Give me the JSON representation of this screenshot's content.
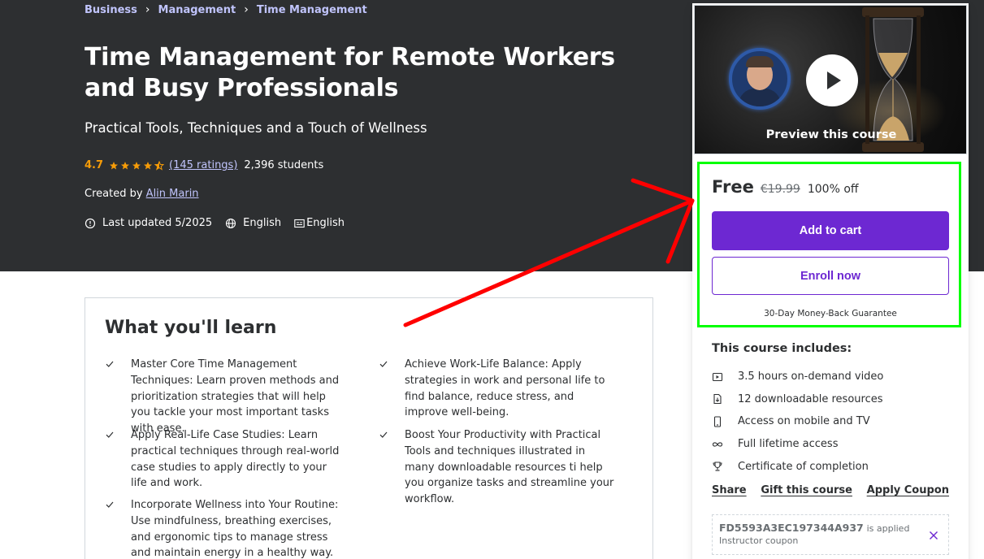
{
  "breadcrumb": {
    "items": [
      "Business",
      "Management",
      "Time Management"
    ],
    "separator": "›"
  },
  "course": {
    "title": "Time Management for Remote Workers and Busy Professionals",
    "subtitle": "Practical Tools, Techniques and a Touch of Wellness",
    "rating": "4.7",
    "rating_stars": 4.5,
    "ratings_count": "(145 ratings)",
    "students": "2,396 students",
    "created_by_label": "Created by",
    "author": "Alin Marin",
    "last_updated": "Last updated 5/2025",
    "language": "English",
    "captions": "English"
  },
  "learn": {
    "heading": "What you'll learn",
    "items": [
      "Master Core Time Management Techniques: Learn proven methods and prioritization strategies that will help you tackle your most important tasks with ease.",
      "Achieve Work-Life Balance: Apply strategies in work and personal life to find balance, reduce stress, and improve well-being.",
      "Apply Real-Life Case Studies: Learn practical techniques through real-world case studies to apply directly to your life and work.",
      "Boost Your Productivity with Practical Tools and techniques illustrated in many downloadable resources ti help you organize tasks and streamline your workflow.",
      "Incorporate Wellness into Your Routine: Use mindfulness, breathing exercises, and ergonomic tips to manage stress and maintain energy in a healthy way."
    ]
  },
  "sidebar": {
    "preview_label": "Preview this course",
    "price_current": "Free",
    "price_original": "€19.99",
    "discount": "100% off",
    "add_to_cart": "Add to cart",
    "enroll_now": "Enroll now",
    "guarantee": "30-Day Money-Back Guarantee",
    "includes_title": "This course includes:",
    "includes": [
      {
        "icon": "video-icon",
        "label": "3.5 hours on-demand video"
      },
      {
        "icon": "file-download-icon",
        "label": "12 downloadable resources"
      },
      {
        "icon": "mobile-icon",
        "label": "Access on mobile and TV"
      },
      {
        "icon": "infinity-icon",
        "label": "Full lifetime access"
      },
      {
        "icon": "trophy-icon",
        "label": "Certificate of completion"
      }
    ],
    "actions": [
      "Share",
      "Gift this course",
      "Apply Coupon"
    ],
    "coupon": {
      "code": "FD5593A3EC197344A937",
      "applied_text": "is applied",
      "type": "Instructor coupon"
    }
  },
  "colors": {
    "hero_bg": "#2d2f31",
    "link_purple": "#c0c4fc",
    "star_orange": "#f69c08",
    "brand_purple": "#6d28d2",
    "highlight_green": "#00ff00",
    "annotation_red": "#ff0000"
  }
}
